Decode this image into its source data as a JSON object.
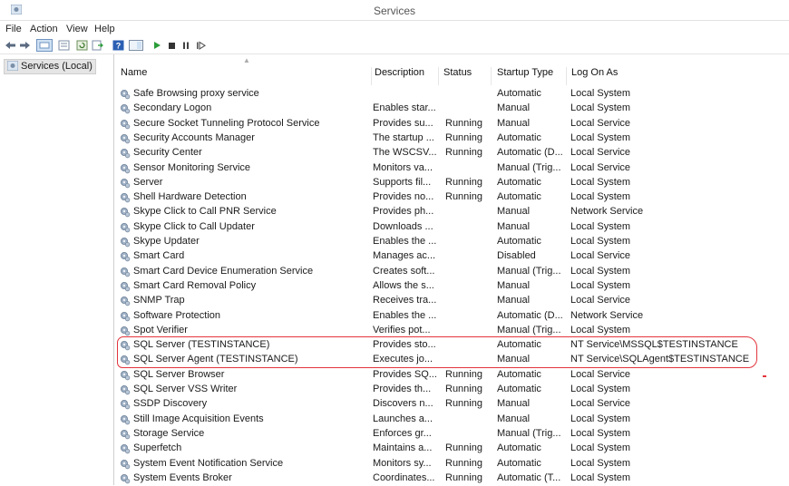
{
  "window": {
    "title": "Services",
    "icon": "services-gear-icon"
  },
  "menu": [
    "File",
    "Action",
    "View",
    "Help"
  ],
  "toolbar": [
    "back-arrow-icon",
    "forward-arrow-icon",
    "console-tree-icon",
    "properties-icon",
    "refresh-icon",
    "export-list-icon",
    "help-icon",
    "show-pane-icon",
    "start-service-icon",
    "stop-service-icon",
    "pause-service-icon",
    "restart-service-icon"
  ],
  "tree": {
    "label": "Services (Local)"
  },
  "columns": {
    "name": "Name",
    "description": "Description",
    "status": "Status",
    "startup": "Startup Type",
    "logon": "Log On As"
  },
  "rows": [
    {
      "name": "Safe Browsing proxy service",
      "description": "",
      "status": "",
      "startup": "Automatic",
      "logon": "Local System"
    },
    {
      "name": "Secondary Logon",
      "description": "Enables star...",
      "status": "",
      "startup": "Manual",
      "logon": "Local System"
    },
    {
      "name": "Secure Socket Tunneling Protocol Service",
      "description": "Provides su...",
      "status": "Running",
      "startup": "Manual",
      "logon": "Local Service"
    },
    {
      "name": "Security Accounts Manager",
      "description": "The startup ...",
      "status": "Running",
      "startup": "Automatic",
      "logon": "Local System"
    },
    {
      "name": "Security Center",
      "description": "The WSCSV...",
      "status": "Running",
      "startup": "Automatic (D...",
      "logon": "Local Service"
    },
    {
      "name": "Sensor Monitoring Service",
      "description": "Monitors va...",
      "status": "",
      "startup": "Manual (Trig...",
      "logon": "Local Service"
    },
    {
      "name": "Server",
      "description": "Supports fil...",
      "status": "Running",
      "startup": "Automatic",
      "logon": "Local System"
    },
    {
      "name": "Shell Hardware Detection",
      "description": "Provides no...",
      "status": "Running",
      "startup": "Automatic",
      "logon": "Local System"
    },
    {
      "name": "Skype Click to Call PNR Service",
      "description": "Provides ph...",
      "status": "",
      "startup": "Manual",
      "logon": "Network Service"
    },
    {
      "name": "Skype Click to Call Updater",
      "description": "Downloads ...",
      "status": "",
      "startup": "Manual",
      "logon": "Local System"
    },
    {
      "name": "Skype Updater",
      "description": "Enables the ...",
      "status": "",
      "startup": "Automatic",
      "logon": "Local System"
    },
    {
      "name": "Smart Card",
      "description": "Manages ac...",
      "status": "",
      "startup": "Disabled",
      "logon": "Local Service"
    },
    {
      "name": "Smart Card Device Enumeration Service",
      "description": "Creates soft...",
      "status": "",
      "startup": "Manual (Trig...",
      "logon": "Local System"
    },
    {
      "name": "Smart Card Removal Policy",
      "description": "Allows the s...",
      "status": "",
      "startup": "Manual",
      "logon": "Local System"
    },
    {
      "name": "SNMP Trap",
      "description": "Receives tra...",
      "status": "",
      "startup": "Manual",
      "logon": "Local Service"
    },
    {
      "name": "Software Protection",
      "description": "Enables the ...",
      "status": "",
      "startup": "Automatic (D...",
      "logon": "Network Service"
    },
    {
      "name": "Spot Verifier",
      "description": "Verifies pot...",
      "status": "",
      "startup": "Manual (Trig...",
      "logon": "Local System"
    },
    {
      "name": "SQL Server (TESTINSTANCE)",
      "description": "Provides sto...",
      "status": "",
      "startup": "Automatic",
      "logon": "NT Service\\MSSQL$TESTINSTANCE"
    },
    {
      "name": "SQL Server Agent (TESTINSTANCE)",
      "description": "Executes jo...",
      "status": "",
      "startup": "Manual",
      "logon": "NT Service\\SQLAgent$TESTINSTANCE"
    },
    {
      "name": "SQL Server Browser",
      "description": "Provides SQ...",
      "status": "Running",
      "startup": "Automatic",
      "logon": "Local Service"
    },
    {
      "name": "SQL Server VSS Writer",
      "description": "Provides th...",
      "status": "Running",
      "startup": "Automatic",
      "logon": "Local System"
    },
    {
      "name": "SSDP Discovery",
      "description": "Discovers n...",
      "status": "Running",
      "startup": "Manual",
      "logon": "Local Service"
    },
    {
      "name": "Still Image Acquisition Events",
      "description": "Launches a...",
      "status": "",
      "startup": "Manual",
      "logon": "Local System"
    },
    {
      "name": "Storage Service",
      "description": "Enforces gr...",
      "status": "",
      "startup": "Manual (Trig...",
      "logon": "Local System"
    },
    {
      "name": "Superfetch",
      "description": "Maintains a...",
      "status": "Running",
      "startup": "Automatic",
      "logon": "Local System"
    },
    {
      "name": "System Event Notification Service",
      "description": "Monitors sy...",
      "status": "Running",
      "startup": "Automatic",
      "logon": "Local System"
    },
    {
      "name": "System Events Broker",
      "description": "Coordinates...",
      "status": "Running",
      "startup": "Automatic (T...",
      "logon": "Local System"
    }
  ],
  "colors": {
    "highlight_outline": "#e2353d",
    "play_green": "#2a9d3a",
    "tree_selected": "#e5e5e5"
  }
}
